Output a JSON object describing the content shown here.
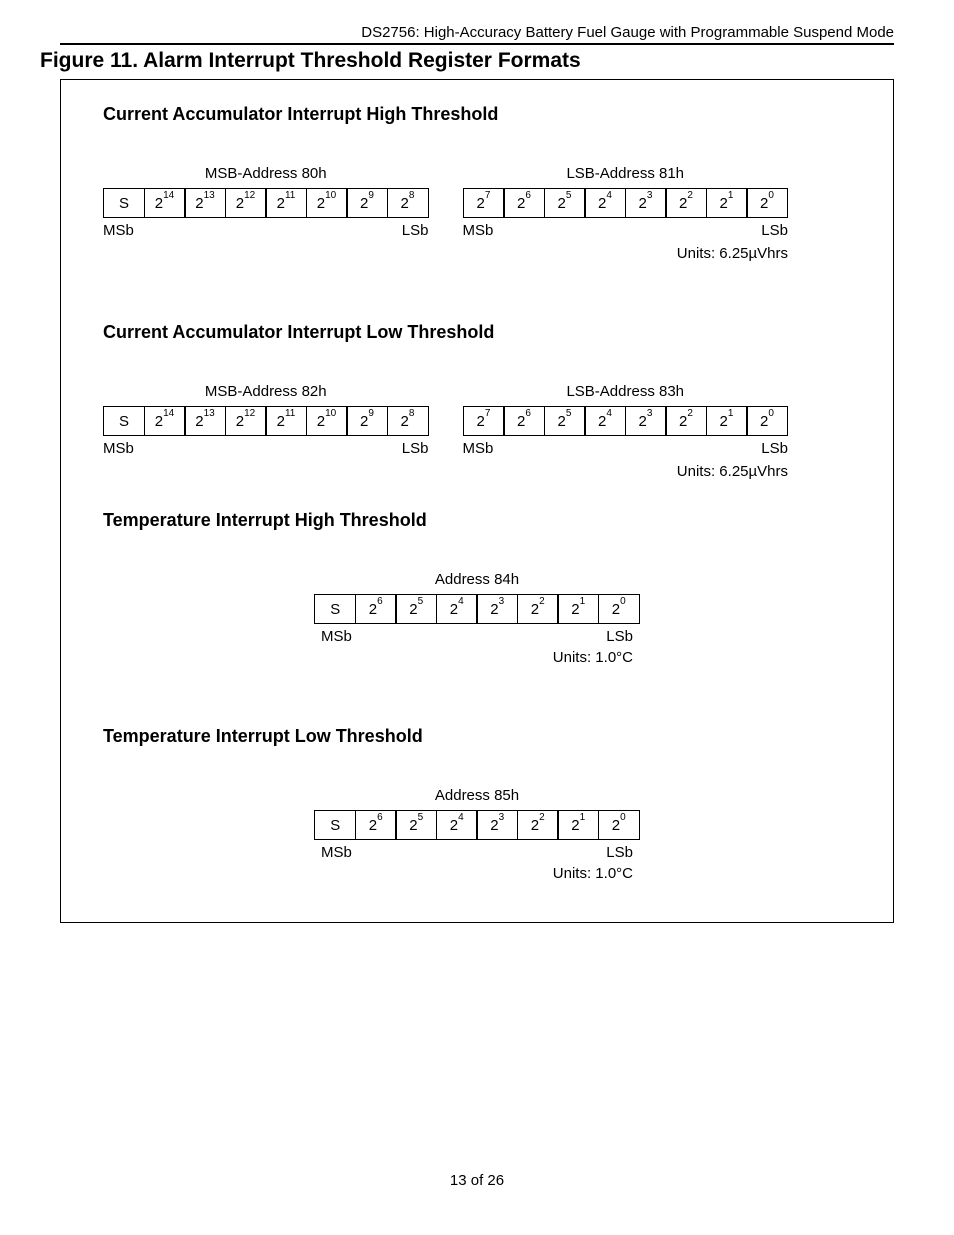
{
  "header": "DS2756: High-Accuracy Battery Fuel Gauge with Programmable Suspend Mode",
  "figure_title": "Figure 11. Alarm Interrupt Threshold Register Formats",
  "footer": "13 of 26",
  "sections": [
    {
      "title": "Current Accumulator Interrupt High Threshold",
      "type": "double",
      "msb": {
        "address": "MSB-Address 80h",
        "bits": [
          "S",
          "2^14",
          "2^13",
          "2^12",
          "2^11",
          "2^10",
          "2^9",
          "2^8"
        ],
        "msb_label": "MSb",
        "lsb_label": "LSb"
      },
      "lsb": {
        "address": "LSB-Address 81h",
        "bits": [
          "2^7",
          "2^6",
          "2^5",
          "2^4",
          "2^3",
          "2^2",
          "2^1",
          "2^0"
        ],
        "msb_label": "MSb",
        "lsb_label": "LSb",
        "units": "Units: 6.25µVhrs"
      }
    },
    {
      "title": "Current Accumulator Interrupt Low Threshold",
      "type": "double",
      "msb": {
        "address": "MSB-Address 82h",
        "bits": [
          "S",
          "2^14",
          "2^13",
          "2^12",
          "2^11",
          "2^10",
          "2^9",
          "2^8"
        ],
        "msb_label": "MSb",
        "lsb_label": "LSb"
      },
      "lsb": {
        "address": "LSB-Address 83h",
        "bits": [
          "2^7",
          "2^6",
          "2^5",
          "2^4",
          "2^3",
          "2^2",
          "2^1",
          "2^0"
        ],
        "msb_label": "MSb",
        "lsb_label": "LSb",
        "units": "Units: 6.25µVhrs"
      }
    },
    {
      "title": "Temperature Interrupt High Threshold",
      "type": "single",
      "address": "Address 84h",
      "bits": [
        "S",
        "2^6",
        "2^5",
        "2^4",
        "2^3",
        "2^2",
        "2^1",
        "2^0"
      ],
      "msb_label": "MSb",
      "lsb_label": "LSb",
      "units": "Units: 1.0°C"
    },
    {
      "title": "Temperature Interrupt Low Threshold",
      "type": "single",
      "address": "Address 85h",
      "bits": [
        "S",
        "2^6",
        "2^5",
        "2^4",
        "2^3",
        "2^2",
        "2^1",
        "2^0"
      ],
      "msb_label": "MSb",
      "lsb_label": "LSb",
      "units": "Units: 1.0°C"
    }
  ]
}
